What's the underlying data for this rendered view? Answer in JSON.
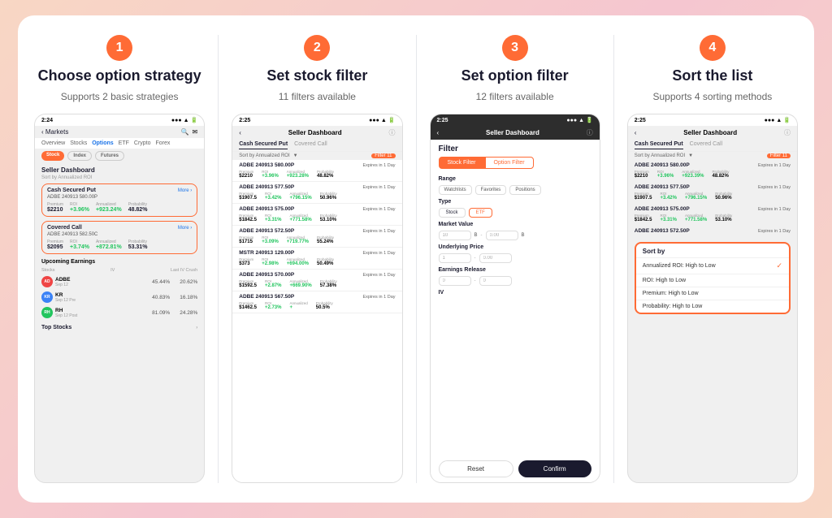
{
  "steps": [
    {
      "number": "1",
      "title": "Choose option strategy",
      "subtitle": "Supports 2 basic strategies"
    },
    {
      "number": "2",
      "title": "Set stock filter",
      "subtitle": "11 filters available"
    },
    {
      "number": "3",
      "title": "Set option filter",
      "subtitle": "12 filters available"
    },
    {
      "number": "4",
      "title": "Sort  the list",
      "subtitle": "Supports 4 sorting methods"
    }
  ],
  "step1": {
    "time": "2:24",
    "nav_items": [
      "Overview",
      "Stocks",
      "Options",
      "ETF",
      "Crypto",
      "Forex"
    ],
    "active_nav": "Options",
    "pills": [
      "Stock",
      "Index",
      "Futures"
    ],
    "section_title": "Seller Dashboard",
    "sort_label": "Sort by Annualized ROI",
    "strategies": [
      {
        "name": "Cash Secured Put",
        "stock": "ADBE 240913 580.00P",
        "premium": "$2210",
        "roi": "+3.96%",
        "annualized": "+923.24%",
        "probability": "48.82%"
      },
      {
        "name": "Covered Call",
        "stock": "ADBE 240913 582.50C",
        "premium": "$2095",
        "roi": "+3.74%",
        "annualized": "+872.81%",
        "probability": "53.31%"
      }
    ],
    "upcoming_title": "Upcoming Earnings",
    "earnings_cols": [
      "Stocks",
      "IV",
      "Last IV Crush"
    ],
    "earnings": [
      {
        "ticker": "ADBE",
        "date": "Sep 12",
        "avatar": "AD",
        "color": "av-red",
        "iv": "45.44%",
        "crush": "20.62%"
      },
      {
        "ticker": "KR",
        "date": "Sep 12 Pre",
        "avatar": "KR",
        "color": "av-blue",
        "iv": "40.83%",
        "crush": "16.18%"
      },
      {
        "ticker": "RH",
        "date": "Sep 12 Post",
        "avatar": "RH",
        "color": "av-green",
        "iv": "81.09%",
        "crush": "24.28%"
      }
    ],
    "top_stocks_label": "Top Stocks"
  },
  "step2": {
    "time": "2:25",
    "page_title": "Seller Dashboard",
    "tabs": [
      "Cash Secured Put",
      "Covered Call"
    ],
    "active_tab": "Cash Secured Put",
    "sort_label": "Sort by Annualized ROI",
    "filter_count": "Filter 11",
    "options": [
      {
        "ticker": "ADBE 240913 580.00P",
        "expires": "Expires in 1 Day",
        "premium": "$2210",
        "roi": "+3.96%",
        "annualized": "+923.28%",
        "probability": "48.82%"
      },
      {
        "ticker": "ADBE 240913 577.50P",
        "expires": "Expires in 1 Day",
        "premium": "$1907.5",
        "roi": "+3.42%",
        "annualized": "+796.15%",
        "probability": "50.96%"
      },
      {
        "ticker": "ADBE 240913 575.00P",
        "expires": "Expires in 1 Day",
        "premium": "$1842.5",
        "roi": "+3.31%",
        "annualized": "+771.58%",
        "probability": "53.10%"
      },
      {
        "ticker": "ADBE 240913 572.50P",
        "expires": "Expires in 1 Day",
        "premium": "$1715",
        "roi": "+3.09%",
        "annualized": "+719.77%",
        "probability": "55.24%"
      },
      {
        "ticker": "MSTR 240913 129.00P",
        "expires": "Expires in 1 Day",
        "premium": "$373",
        "roi": "+2.98%",
        "annualized": "+694.00%",
        "probability": "50.49%"
      },
      {
        "ticker": "ADBE 240913 570.00P",
        "expires": "Expires in 1 Day",
        "premium": "$1592.5",
        "roi": "+2.87%",
        "annualized": "+669.90%",
        "probability": "57.38%"
      },
      {
        "ticker": "ADBE 240913 567.50P",
        "expires": "Expires in 1 Day",
        "premium": "$1462.5",
        "roi": "+2.73%",
        "annualized": "+",
        "probability": "50.5%"
      }
    ]
  },
  "step3": {
    "time": "2:25",
    "page_title": "Seller Dashboard",
    "filter_title": "Filter",
    "tabs": [
      "Stock Filter",
      "Option Filter"
    ],
    "active_tab": "Stock Filter",
    "sections": [
      {
        "label": "Range",
        "items": [
          "Watchlists",
          "Favorites",
          "Positions"
        ]
      },
      {
        "label": "Type",
        "items": [
          "Stock",
          "ETF"
        ]
      },
      {
        "label": "Market Value",
        "input_left": "10",
        "input_right": "0.00",
        "separator": "B",
        "unit": "B"
      },
      {
        "label": "Underlying Price",
        "input_left": "1",
        "input_right": "0.00",
        "separator": "-"
      },
      {
        "label": "Earnings Release",
        "input_left": "0",
        "input_right": "0",
        "separator": "-"
      },
      {
        "label": "IV",
        "input_left": "",
        "input_right": ""
      }
    ],
    "reset_label": "Reset",
    "confirm_label": "Confirm"
  },
  "step4": {
    "time": "2:25",
    "page_title": "Seller Dashboard",
    "tabs": [
      "Cash Secured Put",
      "Covered Call"
    ],
    "active_tab": "Cash Secured Put",
    "sort_label": "Sort by Annualized ROI",
    "filter_count": "Filter 11",
    "options": [
      {
        "ticker": "ADBE 240913 580.00P",
        "expires": "Expires in 1 Day",
        "premium": "$2210",
        "roi": "+3.96%",
        "annualized": "+923.39%",
        "probability": "48.82%"
      },
      {
        "ticker": "ADBE 240913 577.50P",
        "expires": "Expires in 1 Day",
        "premium": "$1907.5",
        "roi": "+3.42%",
        "annualized": "+796.15%",
        "probability": "50.96%"
      },
      {
        "ticker": "ADBE 240913 575.00P",
        "expires": "Expires in 1 Day",
        "premium": "$1842.5",
        "roi": "+3.31%",
        "annualized": "+771.58%",
        "probability": "53.10%"
      },
      {
        "ticker": "ADBE 240913 572.50P",
        "expires": "Expires in 1 Day",
        "premium": "",
        "roi": "",
        "annualized": "",
        "probability": ""
      }
    ],
    "sort_panel": {
      "title": "Sort by",
      "options": [
        {
          "label": "Annualized ROI: High to Low",
          "selected": true
        },
        {
          "label": "ROI: High to Low",
          "selected": false
        },
        {
          "label": "Premium: High to Low",
          "selected": false
        },
        {
          "label": "Probability: High to Low",
          "selected": false
        }
      ]
    }
  }
}
